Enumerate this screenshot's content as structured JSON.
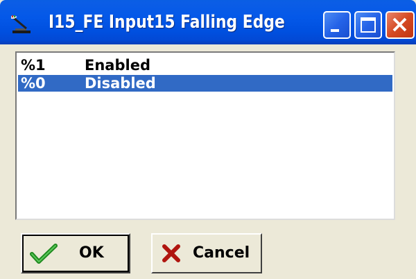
{
  "window": {
    "title": "I15_FE Input15 Falling Edge",
    "icon": "tool-icon"
  },
  "titlebar_buttons": [
    {
      "name": "minimize-icon"
    },
    {
      "name": "maximize-icon"
    },
    {
      "name": "close-icon"
    }
  ],
  "options": [
    {
      "code": "%1",
      "label": "Enabled",
      "selected": false
    },
    {
      "code": "%0",
      "label": "Disabled",
      "selected": true
    }
  ],
  "buttons": {
    "ok_label": "OK",
    "ok_icon": "checkmark-icon",
    "cancel_label": "Cancel",
    "cancel_icon": "x-icon"
  },
  "colors": {
    "titlebar": "#0050e0",
    "selection": "#316ac5",
    "dialog_bg": "#ece9d8",
    "close_button": "#d54a23"
  }
}
